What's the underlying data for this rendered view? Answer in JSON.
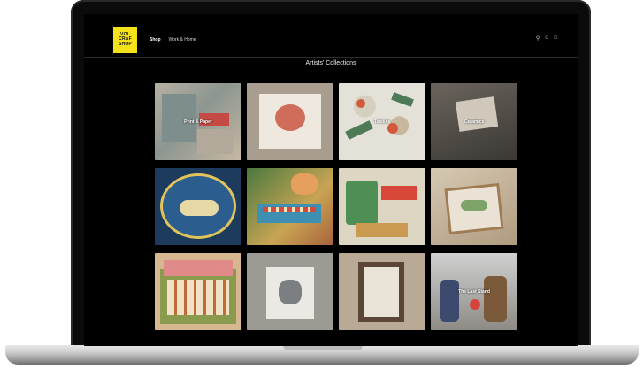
{
  "site": {
    "logo_lines": [
      "VOL",
      "CRAF",
      "SHOP"
    ],
    "nav": [
      {
        "label": "Shop",
        "active": true
      },
      {
        "label": "Work & Home",
        "active": false
      }
    ],
    "header_icons": [
      "search-icon",
      "account-icon",
      "cart-icon"
    ]
  },
  "page": {
    "title": "Artists' Collections"
  },
  "collections": [
    {
      "label": "Print & Paper",
      "icon": "artwork-thumbnail"
    },
    {
      "label": "",
      "icon": "artwork-thumbnail"
    },
    {
      "label": "Textiles",
      "icon": "artwork-thumbnail"
    },
    {
      "label": "Ceramics",
      "icon": "artwork-thumbnail"
    },
    {
      "label": "",
      "icon": "artwork-thumbnail"
    },
    {
      "label": "",
      "icon": "artwork-thumbnail"
    },
    {
      "label": "",
      "icon": "artwork-thumbnail"
    },
    {
      "label": "",
      "icon": "artwork-thumbnail"
    },
    {
      "label": "",
      "icon": "artwork-thumbnail"
    },
    {
      "label": "",
      "icon": "artwork-thumbnail"
    },
    {
      "label": "",
      "icon": "artwork-thumbnail"
    },
    {
      "label": "The Last Stand",
      "icon": "artwork-thumbnail"
    }
  ],
  "colors": {
    "logo_bg": "#f4e11b",
    "screen_bg": "#000000",
    "laptop_silver": "#cfcfcf"
  }
}
